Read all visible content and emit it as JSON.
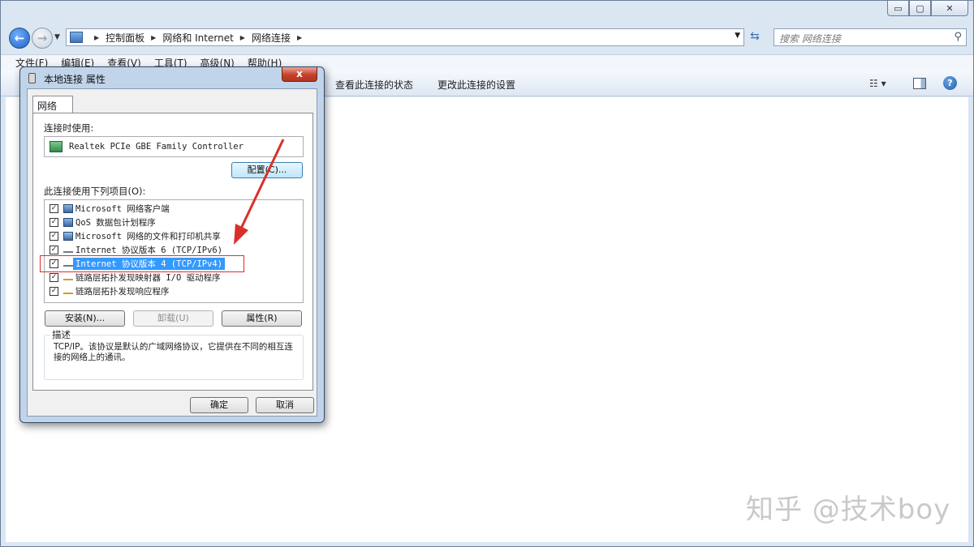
{
  "window": {
    "caption_minimize": "▭",
    "caption_maximize": "▢",
    "caption_close": "✕"
  },
  "nav": {
    "breadcrumbs": [
      "控制面板",
      "网络和 Internet",
      "网络连接"
    ],
    "search_placeholder": "搜索 网络连接"
  },
  "menu": {
    "items": [
      "文件(F)",
      "编辑(E)",
      "查看(V)",
      "工具(T)",
      "高级(N)",
      "帮助(H)"
    ]
  },
  "command_bar": {
    "view_status": "查看此连接的状态",
    "change_settings": "更改此连接的设置"
  },
  "dialog": {
    "title": "本地连接 属性",
    "close_label": "x",
    "tab_label": "网络",
    "connect_using_label": "连接时使用:",
    "adapter_name": "Realtek PCIe GBE Family Controller",
    "configure_label": "配置(C)...",
    "items_label": "此连接使用下列项目(O):",
    "items": [
      {
        "label": "Microsoft 网络客户端",
        "checked": true,
        "icon": "network-client-icon"
      },
      {
        "label": "QoS 数据包计划程序",
        "checked": true,
        "icon": "qos-scheduler-icon"
      },
      {
        "label": "Microsoft 网络的文件和打印机共享",
        "checked": true,
        "icon": "file-printer-sharing-icon"
      },
      {
        "label": "Internet 协议版本 6 (TCP/IPv6)",
        "checked": true,
        "icon": "protocol-icon"
      },
      {
        "label": "Internet 协议版本 4 (TCP/IPv4)",
        "checked": true,
        "icon": "protocol-icon",
        "selected": true
      },
      {
        "label": "链路层拓扑发现映射器 I/O 驱动程序",
        "checked": true,
        "icon": "lltd-icon"
      },
      {
        "label": "链路层拓扑发现响应程序",
        "checked": true,
        "icon": "lltd-icon"
      }
    ],
    "install_label": "安装(N)...",
    "uninstall_label": "卸载(U)",
    "properties_label": "属性(R)",
    "description_label": "描述",
    "description_text": "TCP/IP。该协议是默认的广域网络协议，它提供在不同的相互连接的网络上的通讯。",
    "ok_label": "确定",
    "cancel_label": "取消"
  },
  "watermark": "知乎 @技术boy",
  "colors": {
    "selection": "#3399ff",
    "annotation_red": "#d9302a"
  }
}
